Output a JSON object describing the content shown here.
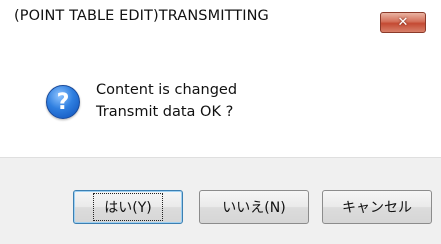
{
  "dialog": {
    "title": "(POINT TABLE EDIT)TRANSMITTING",
    "close_glyph": "✕",
    "icon": "question-icon",
    "message_line1": "Content is changed",
    "message_line2": "Transmit data OK ?"
  },
  "buttons": {
    "yes_label": "はい(Y)",
    "no_label": "いいえ(N)",
    "cancel_label": "キャンセル"
  },
  "colors": {
    "close_button": "#c44a33",
    "footer_bg": "#f0f0f0",
    "default_button_border": "#3c7fb1"
  }
}
